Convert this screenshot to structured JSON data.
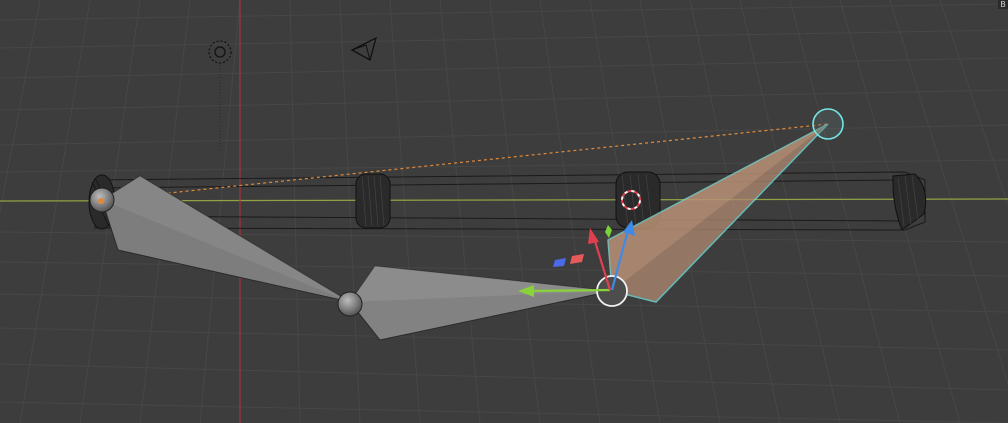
{
  "viewport": {
    "mode": "3d-viewport-solid-wireframe",
    "background_color": "#3d3d3d",
    "grid_color": "#4a4a4a",
    "x_axis_color": "#9aab4c",
    "y_axis_color": "#b8353e"
  },
  "header": {
    "corner_label": "B"
  },
  "scene": {
    "objects": [
      "light",
      "camera",
      "wheel-front-left",
      "wheel-front-right",
      "wheel-rear",
      "wheel-far-right",
      "chassis-frame",
      "armature"
    ],
    "armature_bones": [
      "bone-upper",
      "bone-lower",
      "bone-selected"
    ],
    "selection_color": "#73e5e5",
    "selected_bone_fill": "#b08a70",
    "bone_fill": "#7a7a7a",
    "ik_line_color": "#e08a3a",
    "gizmo": {
      "x_arrow_color": "#8ad23a",
      "y_arrow_color": "#e0404e",
      "z_arrow_color": "#3f8ae8",
      "plane_xy_color": "#e85a5a",
      "plane_xz_color": "#4a6ae8",
      "plane_yz_color": "#7ad23a"
    }
  }
}
